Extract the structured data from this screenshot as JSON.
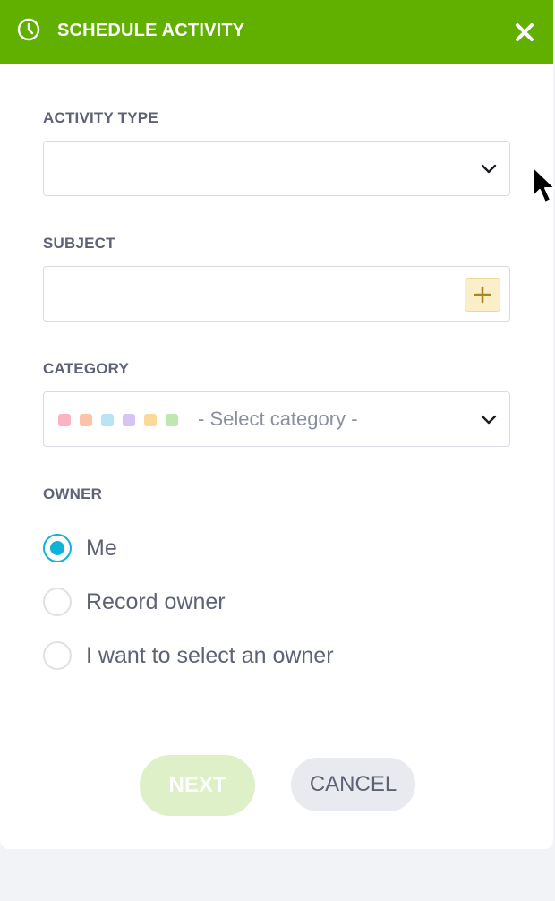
{
  "header": {
    "title": "SCHEDULE ACTIVITY",
    "icon": "clock-icon",
    "close_icon": "close-icon",
    "background_color": "#61b000"
  },
  "activity_type": {
    "label": "ACTIVITY TYPE",
    "value": ""
  },
  "subject": {
    "label": "SUBJECT",
    "value": "",
    "add_icon": "plus-icon"
  },
  "category": {
    "label": "CATEGORY",
    "placeholder": "- Select category -",
    "color_swatches": [
      "#fbb3c2",
      "#fbc4aa",
      "#b8e4f8",
      "#d6c4f6",
      "#fbd996",
      "#bfe8b0"
    ]
  },
  "owner": {
    "label": "OWNER",
    "options": [
      {
        "label": "Me",
        "checked": true
      },
      {
        "label": "Record owner",
        "checked": false
      },
      {
        "label": "I want to select an owner",
        "checked": false
      }
    ]
  },
  "buttons": {
    "next": "NEXT",
    "cancel": "CANCEL"
  },
  "colors": {
    "accent": "#0fb3d6",
    "next_disabled_bg": "#ddf0c8"
  }
}
